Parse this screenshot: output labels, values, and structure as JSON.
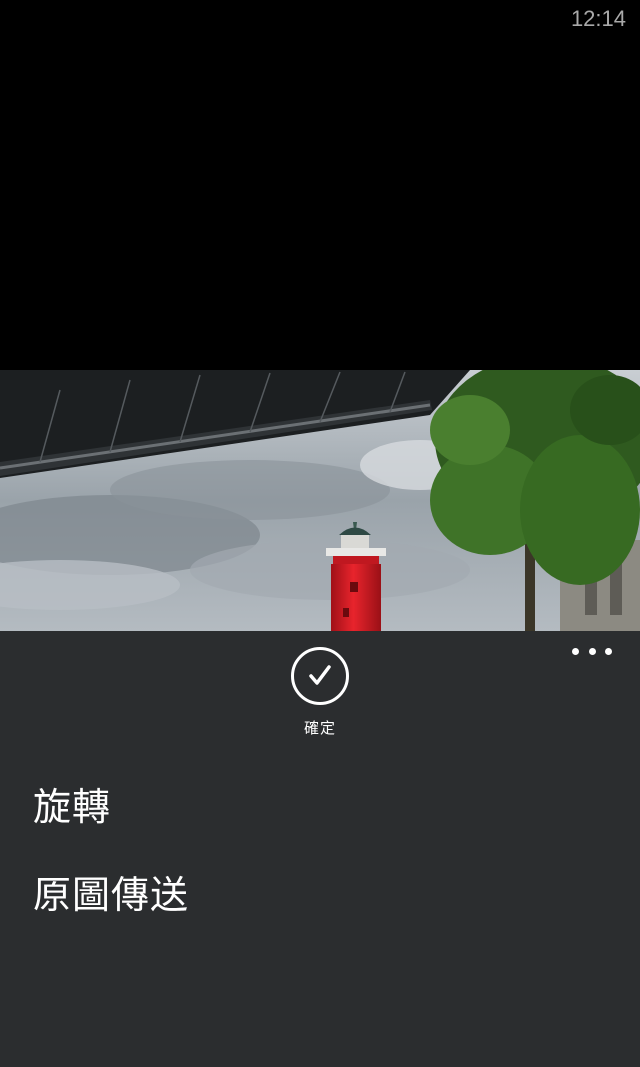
{
  "status_bar": {
    "time": "12:14"
  },
  "photo": {
    "subject": "lighthouse-photo"
  },
  "app_bar": {
    "confirm": {
      "label": "確定",
      "icon": "check-icon"
    },
    "more_icon": "more-dots-icon",
    "menu_items": [
      {
        "label": "旋轉"
      },
      {
        "label": "原圖傳送"
      }
    ]
  },
  "colors": {
    "app_bar_bg": "#2b2d2f",
    "lighthouse_red": "#e0202a",
    "status_text": "#a9a9a9"
  }
}
